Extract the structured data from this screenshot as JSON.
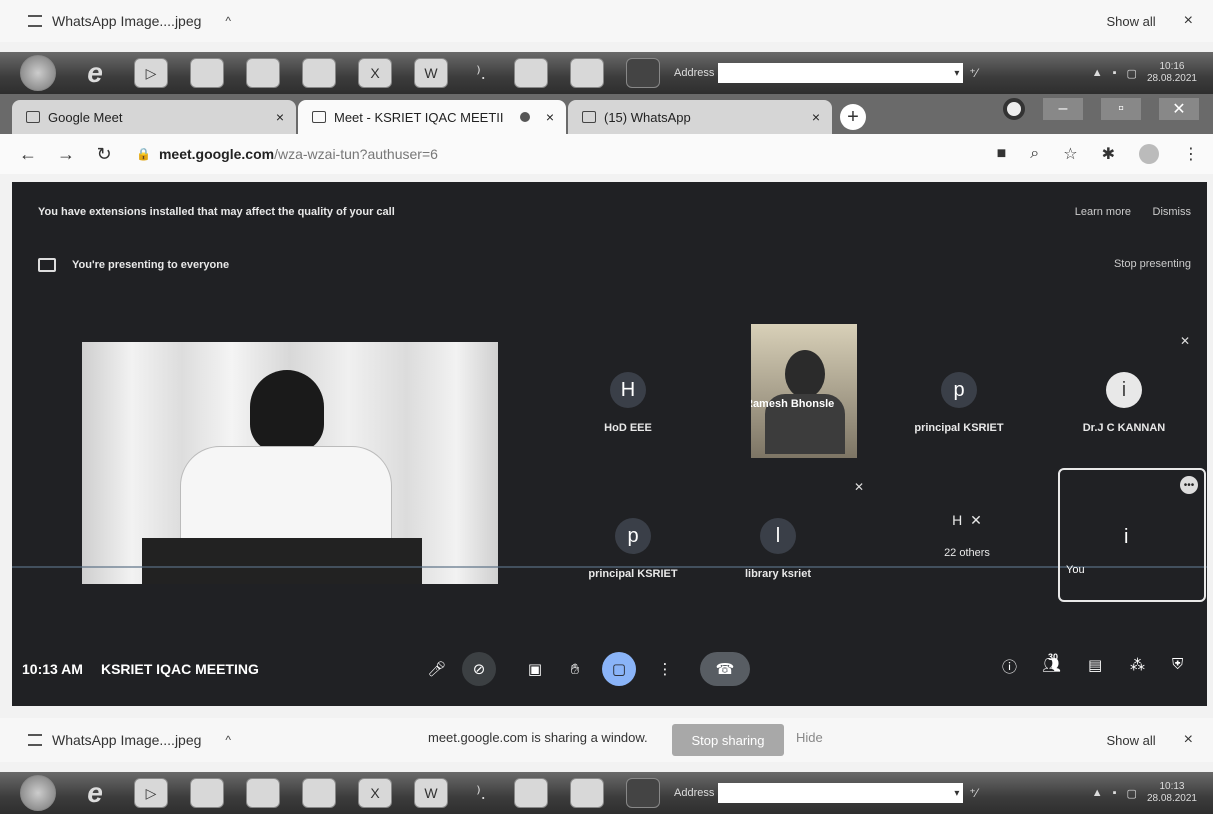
{
  "download_bar_top": {
    "file_name": "WhatsApp Image....jpeg",
    "caret": "^",
    "show_all": "Show all",
    "close": "×"
  },
  "download_bar_bottom": {
    "file_name": "WhatsApp Image....jpeg",
    "caret": "^",
    "sharing_message": "meet.google.com is sharing a window.",
    "stop_sharing": "Stop sharing",
    "hide": "Hide",
    "show_all": "Show all",
    "close": "×"
  },
  "taskbar_top": {
    "address_label": "Address",
    "clock_time": "10:16",
    "clock_date": "28.08.2021"
  },
  "taskbar_bottom": {
    "address_label": "Address",
    "clock_time": "10:13",
    "clock_date": "28.08.2021"
  },
  "tabs": [
    {
      "label": "Google Meet",
      "close": "×"
    },
    {
      "label": "Meet - KSRIET IQAC MEETII",
      "close": "×"
    },
    {
      "label": "(15) WhatsApp",
      "close": "×"
    }
  ],
  "newtab": "+",
  "address": {
    "host": "meet.google.com",
    "path": "/wza-wzai-tun?authuser=6"
  },
  "meet": {
    "extension_warning": "You have extensions installed that may affect the quality of your call",
    "learn_more": "Learn more",
    "dismiss": "Dismiss",
    "presenting_text": "You're presenting to everyone",
    "stop_presenting": "Stop presenting",
    "participants": [
      {
        "initial": "H",
        "name": "HoD EEE"
      },
      {
        "initial": "",
        "name": "Ramesh Bhonsle"
      },
      {
        "initial": "p",
        "name": "principal KSRIET"
      },
      {
        "initial": "i",
        "name": "Dr.J C KANNAN"
      },
      {
        "initial": "p",
        "name": "principal KSRIET"
      },
      {
        "initial": "l",
        "name": "library ksriet"
      },
      {
        "initial": "H",
        "name": "22 others"
      },
      {
        "initial": "i",
        "name": "You"
      }
    ],
    "meeting_time": "10:13 AM",
    "meeting_name": "KSRIET IQAC MEETING",
    "people_count": "30"
  },
  "colors": {
    "meet_bg": "#202124",
    "present_active": "#8ab4f8"
  }
}
